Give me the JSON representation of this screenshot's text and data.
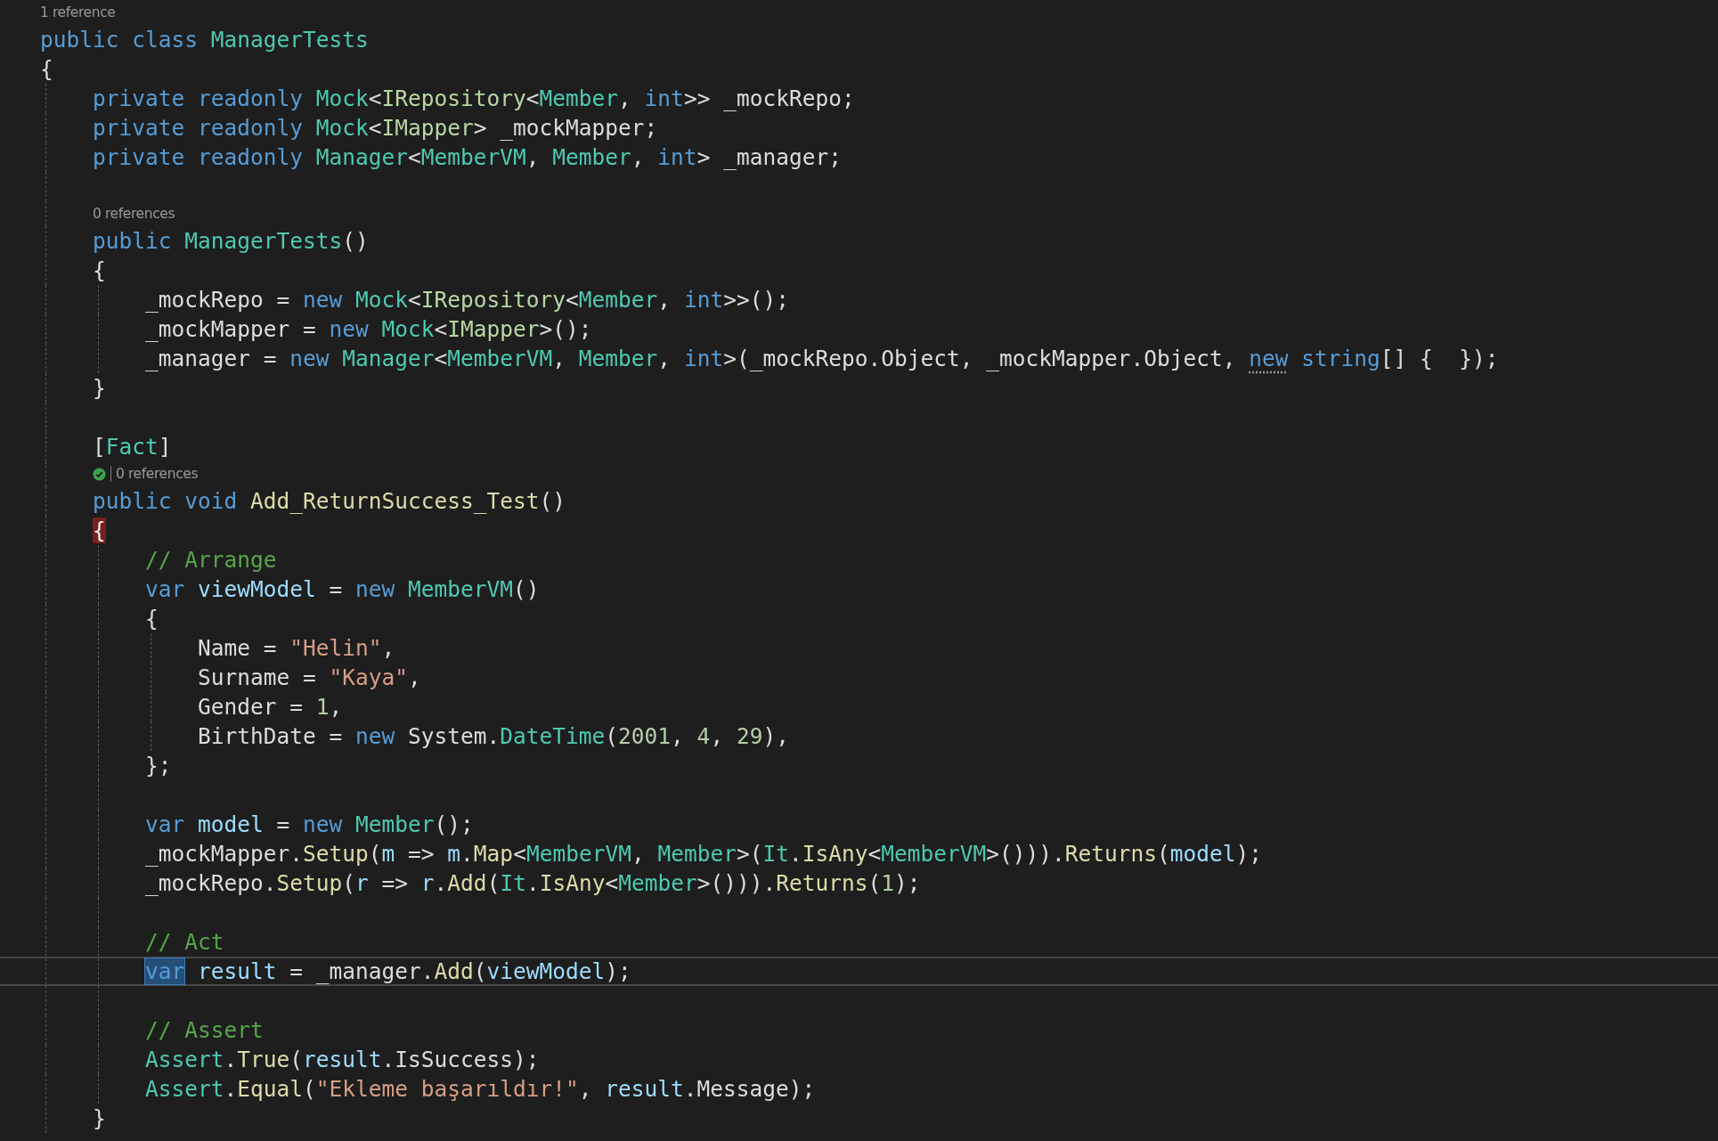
{
  "editor": {
    "lines": [
      {
        "kind": "lens",
        "text": "1 reference",
        "test_passed": false
      },
      {
        "kind": "code",
        "current": false,
        "tokens": [
          {
            "kind": "keyword",
            "text": "public class "
          },
          {
            "kind": "type",
            "text": "ManagerTests"
          }
        ]
      },
      {
        "kind": "code",
        "current": false,
        "tokens": [
          {
            "kind": "plain",
            "text": "{"
          }
        ],
        "children": [
          {
            "kind": "code",
            "current": false,
            "tokens": [
              {
                "kind": "keyword",
                "text": "private readonly "
              },
              {
                "kind": "type",
                "text": "Mock"
              },
              {
                "kind": "plain",
                "text": "<"
              },
              {
                "kind": "interface",
                "text": "IRepository"
              },
              {
                "kind": "plain",
                "text": "<"
              },
              {
                "kind": "type",
                "text": "Member"
              },
              {
                "kind": "plain",
                "text": ", "
              },
              {
                "kind": "keyword",
                "text": "int"
              },
              {
                "kind": "plain",
                "text": ">> _mockRepo;"
              }
            ]
          },
          {
            "kind": "code",
            "current": false,
            "tokens": [
              {
                "kind": "keyword",
                "text": "private readonly "
              },
              {
                "kind": "type",
                "text": "Mock"
              },
              {
                "kind": "plain",
                "text": "<"
              },
              {
                "kind": "interface",
                "text": "IMapper"
              },
              {
                "kind": "plain",
                "text": "> _mockMapper;"
              }
            ]
          },
          {
            "kind": "code",
            "current": false,
            "tokens": [
              {
                "kind": "keyword",
                "text": "private readonly "
              },
              {
                "kind": "type",
                "text": "Manager"
              },
              {
                "kind": "plain",
                "text": "<"
              },
              {
                "kind": "type",
                "text": "MemberVM"
              },
              {
                "kind": "plain",
                "text": ", "
              },
              {
                "kind": "type",
                "text": "Member"
              },
              {
                "kind": "plain",
                "text": ", "
              },
              {
                "kind": "keyword",
                "text": "int"
              },
              {
                "kind": "plain",
                "text": "> _manager;"
              }
            ]
          },
          {
            "kind": "blank"
          },
          {
            "kind": "lens",
            "text": "0 references",
            "test_passed": false
          },
          {
            "kind": "code",
            "current": false,
            "tokens": [
              {
                "kind": "keyword",
                "text": "public "
              },
              {
                "kind": "type",
                "text": "ManagerTests"
              },
              {
                "kind": "plain",
                "text": "()"
              }
            ]
          },
          {
            "kind": "code",
            "current": false,
            "tokens": [
              {
                "kind": "plain",
                "text": "{"
              }
            ],
            "children": [
              {
                "kind": "code",
                "current": false,
                "tokens": [
                  {
                    "kind": "plain",
                    "text": "_mockRepo = "
                  },
                  {
                    "kind": "keyword",
                    "text": "new "
                  },
                  {
                    "kind": "type",
                    "text": "Mock"
                  },
                  {
                    "kind": "plain",
                    "text": "<"
                  },
                  {
                    "kind": "interface",
                    "text": "IRepository"
                  },
                  {
                    "kind": "plain",
                    "text": "<"
                  },
                  {
                    "kind": "type",
                    "text": "Member"
                  },
                  {
                    "kind": "plain",
                    "text": ", "
                  },
                  {
                    "kind": "keyword",
                    "text": "int"
                  },
                  {
                    "kind": "plain",
                    "text": ">>();"
                  }
                ]
              },
              {
                "kind": "code",
                "current": false,
                "tokens": [
                  {
                    "kind": "plain",
                    "text": "_mockMapper = "
                  },
                  {
                    "kind": "keyword",
                    "text": "new "
                  },
                  {
                    "kind": "type",
                    "text": "Mock"
                  },
                  {
                    "kind": "plain",
                    "text": "<"
                  },
                  {
                    "kind": "interface",
                    "text": "IMapper"
                  },
                  {
                    "kind": "plain",
                    "text": ">();"
                  }
                ]
              },
              {
                "kind": "code",
                "current": false,
                "tokens": [
                  {
                    "kind": "plain",
                    "text": "_manager = "
                  },
                  {
                    "kind": "keyword",
                    "text": "new "
                  },
                  {
                    "kind": "type",
                    "text": "Manager"
                  },
                  {
                    "kind": "plain",
                    "text": "<"
                  },
                  {
                    "kind": "type",
                    "text": "MemberVM"
                  },
                  {
                    "kind": "plain",
                    "text": ", "
                  },
                  {
                    "kind": "type",
                    "text": "Member"
                  },
                  {
                    "kind": "plain",
                    "text": ", "
                  },
                  {
                    "kind": "keyword",
                    "text": "int"
                  },
                  {
                    "kind": "plain",
                    "text": ">(_mockRepo.Object, _mockMapper.Object, "
                  },
                  {
                    "kind": "suggested-keyword",
                    "text": "new"
                  },
                  {
                    "kind": "keyword",
                    "text": " string"
                  },
                  {
                    "kind": "plain",
                    "text": "[] {  });"
                  }
                ]
              }
            ]
          },
          {
            "kind": "code",
            "current": false,
            "tokens": [
              {
                "kind": "plain",
                "text": "}"
              }
            ]
          },
          {
            "kind": "blank"
          },
          {
            "kind": "code",
            "current": false,
            "tokens": [
              {
                "kind": "plain",
                "text": "["
              },
              {
                "kind": "type",
                "text": "Fact"
              },
              {
                "kind": "plain",
                "text": "]"
              }
            ]
          },
          {
            "kind": "lens",
            "text": "0 references",
            "test_passed": true
          },
          {
            "kind": "code",
            "current": false,
            "tokens": [
              {
                "kind": "keyword",
                "text": "public void "
              },
              {
                "kind": "method",
                "text": "Add_ReturnSuccess_Test"
              },
              {
                "kind": "plain",
                "text": "()"
              }
            ]
          },
          {
            "kind": "code",
            "current": false,
            "tokens": [
              {
                "kind": "marked-brace",
                "text": "{"
              }
            ],
            "children": [
              {
                "kind": "code",
                "current": false,
                "tokens": [
                  {
                    "kind": "comment",
                    "text": "// Arrange"
                  }
                ]
              },
              {
                "kind": "code",
                "current": false,
                "tokens": [
                  {
                    "kind": "keyword",
                    "text": "var "
                  },
                  {
                    "kind": "local",
                    "text": "viewModel"
                  },
                  {
                    "kind": "plain",
                    "text": " = "
                  },
                  {
                    "kind": "keyword",
                    "text": "new "
                  },
                  {
                    "kind": "type",
                    "text": "MemberVM"
                  },
                  {
                    "kind": "plain",
                    "text": "()"
                  }
                ]
              },
              {
                "kind": "code",
                "current": false,
                "tokens": [
                  {
                    "kind": "plain",
                    "text": "{"
                  }
                ],
                "children": [
                  {
                    "kind": "code",
                    "current": false,
                    "tokens": [
                      {
                        "kind": "plain",
                        "text": "Name = "
                      },
                      {
                        "kind": "string",
                        "text": "\"Helin\""
                      },
                      {
                        "kind": "plain",
                        "text": ","
                      }
                    ]
                  },
                  {
                    "kind": "code",
                    "current": false,
                    "tokens": [
                      {
                        "kind": "plain",
                        "text": "Surname = "
                      },
                      {
                        "kind": "string",
                        "text": "\"Kaya\""
                      },
                      {
                        "kind": "plain",
                        "text": ","
                      }
                    ]
                  },
                  {
                    "kind": "code",
                    "current": false,
                    "tokens": [
                      {
                        "kind": "plain",
                        "text": "Gender = "
                      },
                      {
                        "kind": "number",
                        "text": "1"
                      },
                      {
                        "kind": "plain",
                        "text": ","
                      }
                    ]
                  },
                  {
                    "kind": "code",
                    "current": false,
                    "tokens": [
                      {
                        "kind": "plain",
                        "text": "BirthDate = "
                      },
                      {
                        "kind": "keyword",
                        "text": "new "
                      },
                      {
                        "kind": "plain",
                        "text": "System."
                      },
                      {
                        "kind": "type",
                        "text": "DateTime"
                      },
                      {
                        "kind": "plain",
                        "text": "("
                      },
                      {
                        "kind": "number",
                        "text": "2001"
                      },
                      {
                        "kind": "plain",
                        "text": ", "
                      },
                      {
                        "kind": "number",
                        "text": "4"
                      },
                      {
                        "kind": "plain",
                        "text": ", "
                      },
                      {
                        "kind": "number",
                        "text": "29"
                      },
                      {
                        "kind": "plain",
                        "text": "),"
                      }
                    ]
                  }
                ]
              },
              {
                "kind": "code",
                "current": false,
                "tokens": [
                  {
                    "kind": "plain",
                    "text": "};"
                  }
                ]
              },
              {
                "kind": "blank"
              },
              {
                "kind": "code",
                "current": false,
                "tokens": [
                  {
                    "kind": "keyword",
                    "text": "var "
                  },
                  {
                    "kind": "local",
                    "text": "model"
                  },
                  {
                    "kind": "plain",
                    "text": " = "
                  },
                  {
                    "kind": "keyword",
                    "text": "new "
                  },
                  {
                    "kind": "type",
                    "text": "Member"
                  },
                  {
                    "kind": "plain",
                    "text": "();"
                  }
                ]
              },
              {
                "kind": "code",
                "current": false,
                "tokens": [
                  {
                    "kind": "plain",
                    "text": "_mockMapper."
                  },
                  {
                    "kind": "method",
                    "text": "Setup"
                  },
                  {
                    "kind": "plain",
                    "text": "("
                  },
                  {
                    "kind": "param",
                    "text": "m"
                  },
                  {
                    "kind": "plain",
                    "text": " => "
                  },
                  {
                    "kind": "param",
                    "text": "m"
                  },
                  {
                    "kind": "plain",
                    "text": "."
                  },
                  {
                    "kind": "method",
                    "text": "Map"
                  },
                  {
                    "kind": "plain",
                    "text": "<"
                  },
                  {
                    "kind": "type",
                    "text": "MemberVM"
                  },
                  {
                    "kind": "plain",
                    "text": ", "
                  },
                  {
                    "kind": "type",
                    "text": "Member"
                  },
                  {
                    "kind": "plain",
                    "text": ">("
                  },
                  {
                    "kind": "type",
                    "text": "It"
                  },
                  {
                    "kind": "plain",
                    "text": "."
                  },
                  {
                    "kind": "method",
                    "text": "IsAny"
                  },
                  {
                    "kind": "plain",
                    "text": "<"
                  },
                  {
                    "kind": "type",
                    "text": "MemberVM"
                  },
                  {
                    "kind": "plain",
                    "text": ">()))."
                  },
                  {
                    "kind": "method",
                    "text": "Returns"
                  },
                  {
                    "kind": "plain",
                    "text": "("
                  },
                  {
                    "kind": "local",
                    "text": "model"
                  },
                  {
                    "kind": "plain",
                    "text": ");"
                  }
                ]
              },
              {
                "kind": "code",
                "current": false,
                "tokens": [
                  {
                    "kind": "plain",
                    "text": "_mockRepo."
                  },
                  {
                    "kind": "method",
                    "text": "Setup"
                  },
                  {
                    "kind": "plain",
                    "text": "("
                  },
                  {
                    "kind": "param",
                    "text": "r"
                  },
                  {
                    "kind": "plain",
                    "text": " => "
                  },
                  {
                    "kind": "param",
                    "text": "r"
                  },
                  {
                    "kind": "plain",
                    "text": "."
                  },
                  {
                    "kind": "method",
                    "text": "Add"
                  },
                  {
                    "kind": "plain",
                    "text": "("
                  },
                  {
                    "kind": "type",
                    "text": "It"
                  },
                  {
                    "kind": "plain",
                    "text": "."
                  },
                  {
                    "kind": "method",
                    "text": "IsAny"
                  },
                  {
                    "kind": "plain",
                    "text": "<"
                  },
                  {
                    "kind": "type",
                    "text": "Member"
                  },
                  {
                    "kind": "plain",
                    "text": ">()))."
                  },
                  {
                    "kind": "method",
                    "text": "Returns"
                  },
                  {
                    "kind": "plain",
                    "text": "("
                  },
                  {
                    "kind": "number",
                    "text": "1"
                  },
                  {
                    "kind": "plain",
                    "text": ");"
                  }
                ]
              },
              {
                "kind": "blank"
              },
              {
                "kind": "code",
                "current": false,
                "tokens": [
                  {
                    "kind": "comment",
                    "text": "// Act"
                  }
                ]
              },
              {
                "kind": "code",
                "current": true,
                "tokens": [
                  {
                    "kind": "selected-keyword",
                    "text": "var"
                  },
                  {
                    "kind": "local",
                    "text": " result"
                  },
                  {
                    "kind": "plain",
                    "text": " = _manager."
                  },
                  {
                    "kind": "method",
                    "text": "Add"
                  },
                  {
                    "kind": "plain",
                    "text": "("
                  },
                  {
                    "kind": "local",
                    "text": "viewModel"
                  },
                  {
                    "kind": "plain",
                    "text": ");"
                  }
                ]
              },
              {
                "kind": "blank"
              },
              {
                "kind": "code",
                "current": false,
                "tokens": [
                  {
                    "kind": "comment",
                    "text": "// Assert"
                  }
                ]
              },
              {
                "kind": "code",
                "current": false,
                "tokens": [
                  {
                    "kind": "type",
                    "text": "Assert"
                  },
                  {
                    "kind": "plain",
                    "text": "."
                  },
                  {
                    "kind": "method",
                    "text": "True"
                  },
                  {
                    "kind": "plain",
                    "text": "("
                  },
                  {
                    "kind": "local",
                    "text": "result"
                  },
                  {
                    "kind": "plain",
                    "text": ".IsSuccess);"
                  }
                ]
              },
              {
                "kind": "code",
                "current": false,
                "tokens": [
                  {
                    "kind": "type",
                    "text": "Assert"
                  },
                  {
                    "kind": "plain",
                    "text": "."
                  },
                  {
                    "kind": "method",
                    "text": "Equal"
                  },
                  {
                    "kind": "plain",
                    "text": "("
                  },
                  {
                    "kind": "string",
                    "text": "\"Ekleme başarıldır!\""
                  },
                  {
                    "kind": "plain",
                    "text": ", "
                  },
                  {
                    "kind": "local",
                    "text": "result"
                  },
                  {
                    "kind": "plain",
                    "text": ".Message);"
                  }
                ]
              }
            ]
          },
          {
            "kind": "code",
            "current": false,
            "tokens": [
              {
                "kind": "plain",
                "text": "}"
              }
            ]
          }
        ]
      }
    ]
  }
}
